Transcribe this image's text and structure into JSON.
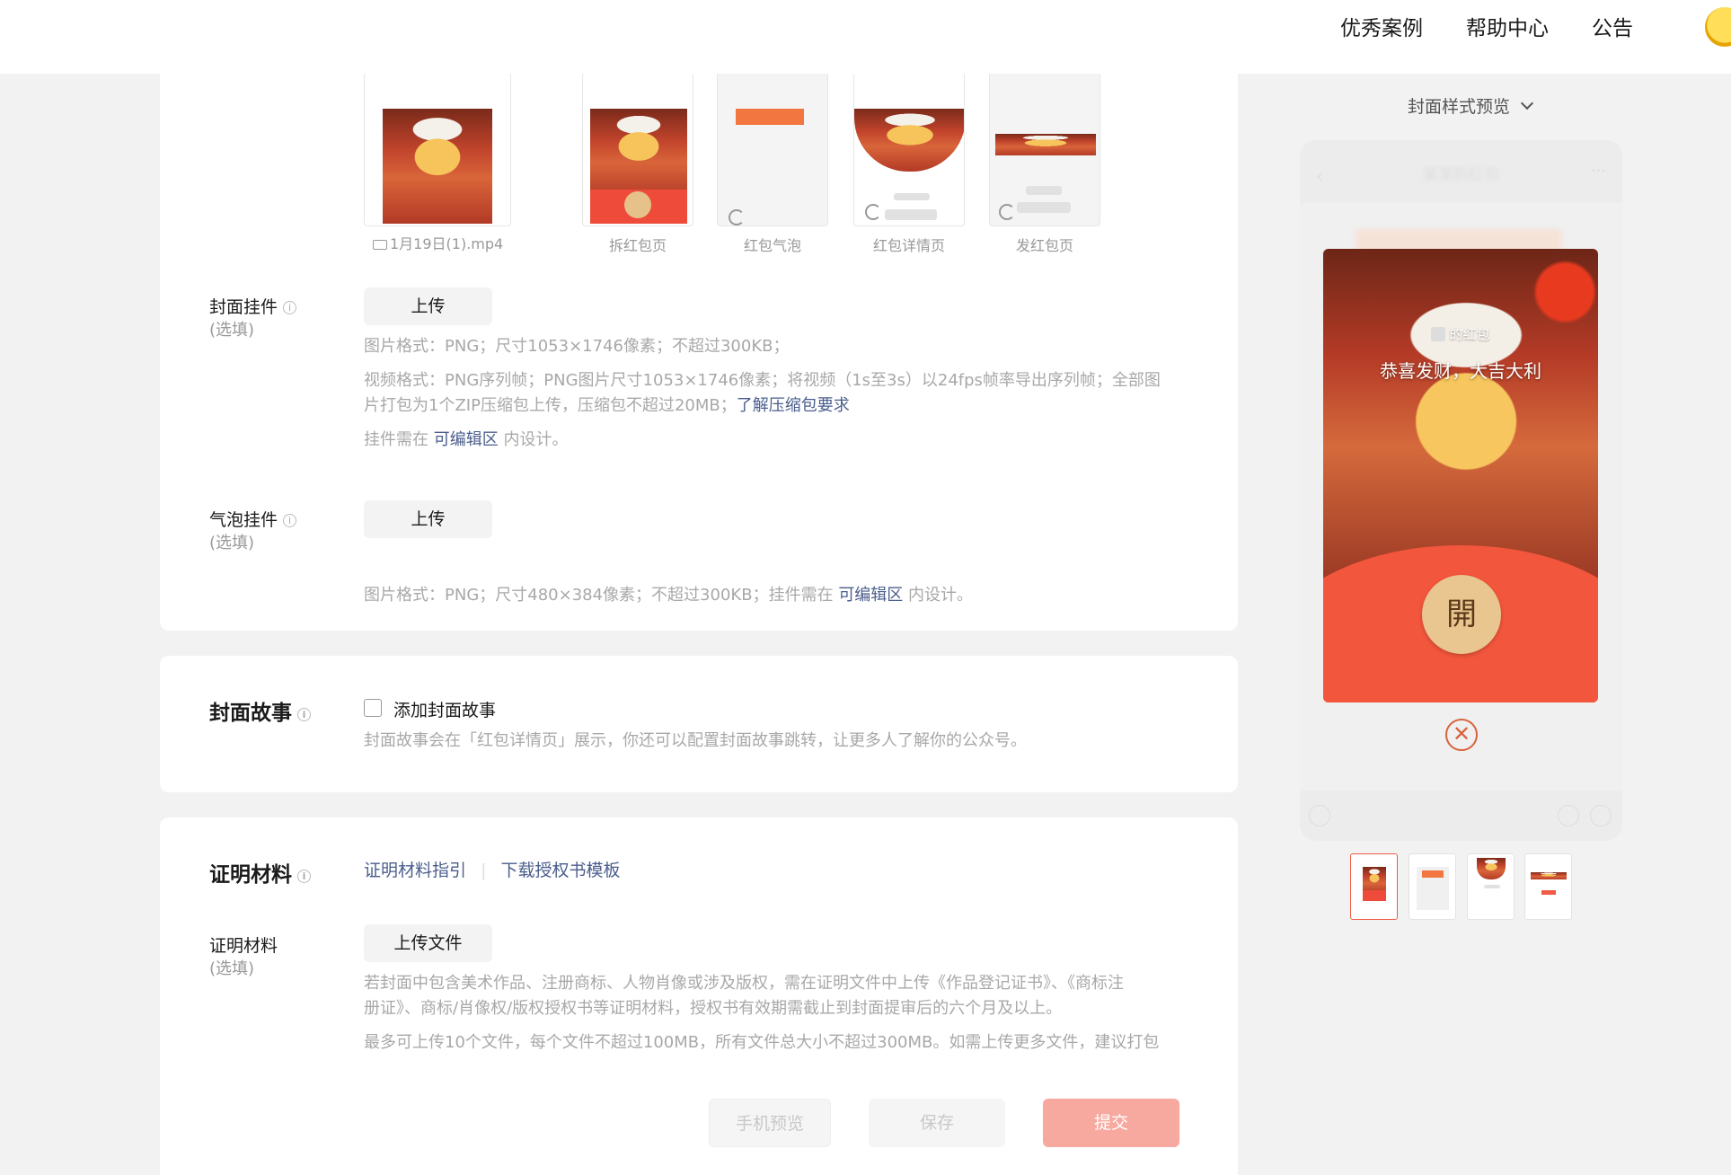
{
  "topnav": {
    "excellent_cases": "优秀案例",
    "help_center": "帮助中心",
    "announcement": "公告"
  },
  "preview_panel": {
    "style_selector": "封面样式预览",
    "phone_header_blurred": "某某的红包",
    "sender_text": "的红包",
    "greeting": "恭喜发财，大吉大利",
    "open_glyph": "開",
    "close_symbol": "✕"
  },
  "media": {
    "file_name": "1月19日(1).mp4",
    "previews": [
      {
        "label": "拆红包页"
      },
      {
        "label": "红包气泡"
      },
      {
        "label": "红包详情页"
      },
      {
        "label": "发红包页"
      }
    ]
  },
  "cover_pendant": {
    "label": "封面挂件",
    "optional": "(选填)",
    "upload": "上传",
    "desc_line1": "图片格式：PNG；尺寸1053×1746像素；不超过300KB；",
    "desc_line2": "视频格式：PNG序列帧；PNG图片尺寸1053×1746像素；将视频（1s至3s）以24fps帧率导出序列帧；全部图",
    "desc_line3_prefix": "片打包为1个ZIP压缩包上传，压缩包不超过20MB；",
    "desc_line3_link": "了解压缩包要求",
    "desc_line4_prefix": "挂件需在",
    "desc_line4_link": "可编辑区",
    "desc_line4_suffix": "内设计。"
  },
  "bubble_pendant": {
    "label": "气泡挂件",
    "optional": "(选填)",
    "upload": "上传",
    "desc_prefix": "图片格式：PNG；尺寸480×384像素；不超过300KB；挂件需在",
    "desc_link": "可编辑区",
    "desc_suffix": "内设计。"
  },
  "cover_story": {
    "title": "封面故事",
    "checkbox_label": "添加封面故事",
    "checked": false,
    "desc": "封面故事会在「红包详情页」展示，你还可以配置封面故事跳转，让更多人了解你的公众号。"
  },
  "proof": {
    "title": "证明材料",
    "link_guide": "证明材料指引",
    "link_template": "下载授权书模板",
    "field_label": "证明材料",
    "optional": "(选填)",
    "upload": "上传文件",
    "desc_line1": "若封面中包含美术作品、注册商标、人物肖像或涉及版权，需在证明文件中上传《作品登记证书》、《商标注",
    "desc_line2": "册证》、商标/肖像权/版权授权书等证明材料，授权书有效期需截止到封面提审后的六个月及以上。",
    "desc_line3": "最多可上传10个文件，每个文件不超过100MB，所有文件总大小不超过300MB。如需上传更多文件，建议打包"
  },
  "footer": {
    "phone_preview": "手机预览",
    "save": "保存",
    "submit": "提交"
  },
  "colors": {
    "accent_red": "#f05a46",
    "submit_bg": "#f7a99f",
    "link": "#4a5d8c",
    "muted": "#a8a8a8"
  }
}
